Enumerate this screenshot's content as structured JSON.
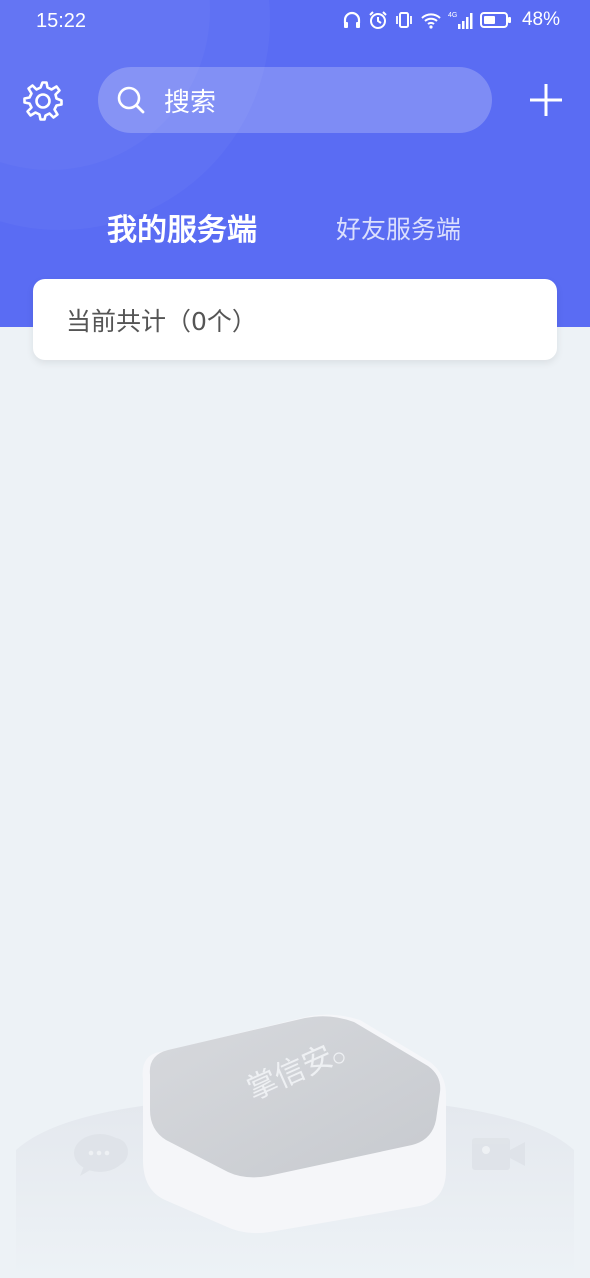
{
  "status_bar": {
    "time": "15:22",
    "battery_percent": "48%",
    "network_label": "4G",
    "icons": [
      "headphones-icon",
      "alarm-icon",
      "vibrate-icon",
      "wifi-icon",
      "signal-icon",
      "battery-icon"
    ]
  },
  "header": {
    "settings_icon": "gear-icon",
    "search_placeholder": "搜索",
    "add_icon": "plus-icon",
    "accent_color": "#5a6cf3"
  },
  "tabs": [
    {
      "label": "我的服务端",
      "active": true
    },
    {
      "label": "好友服务端",
      "active": false
    }
  ],
  "summary": {
    "count_text": "当前共计（0个）"
  },
  "illustration": {
    "brand_text": "掌信安",
    "left_icon": "chat-bubbles-icon",
    "right_icon": "video-camera-icon"
  }
}
